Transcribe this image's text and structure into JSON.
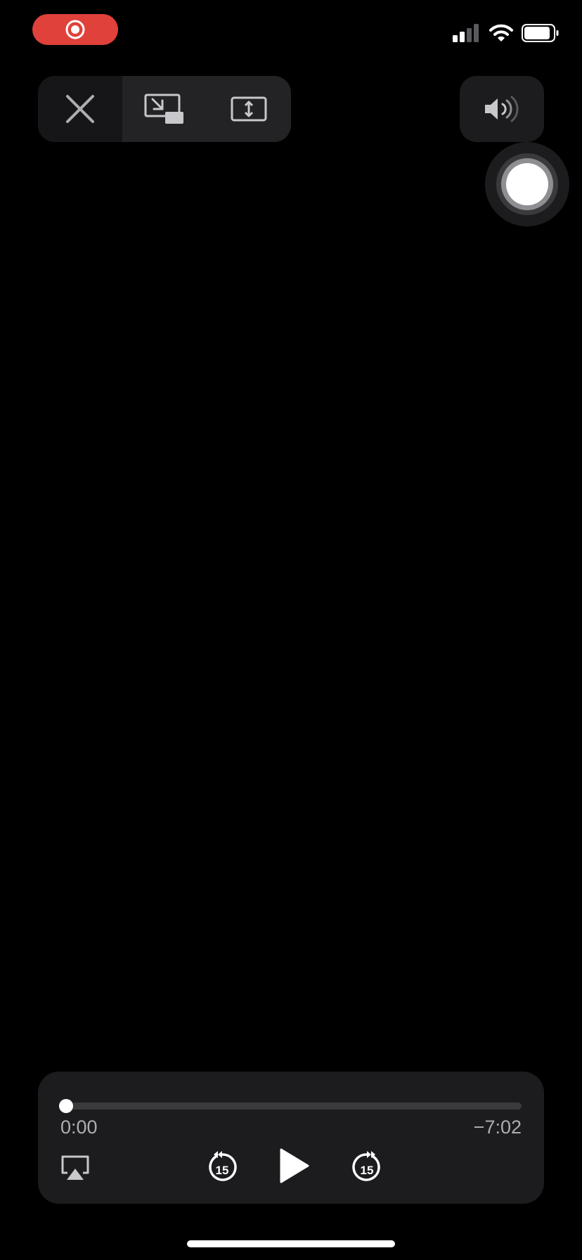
{
  "status_bar": {
    "recording_icon": "screen-record-icon",
    "signal_icon": "cellular-signal-icon",
    "signal_bars_active": 2,
    "signal_bars_total": 4,
    "wifi_icon": "wifi-icon",
    "battery_icon": "battery-icon",
    "battery_level": 0.9
  },
  "top_controls": {
    "close_icon": "close-icon",
    "pip_icon": "picture-in-picture-icon",
    "fit_icon": "aspect-fit-icon",
    "volume_icon": "speaker-volume-icon"
  },
  "assistive_touch": {
    "icon": "assistive-touch-icon"
  },
  "player": {
    "progress": 0.0,
    "elapsed": "0:00",
    "remaining": "−7:02",
    "airplay_icon": "airplay-icon",
    "skip_back_icon": "skip-back-icon",
    "skip_back_label": "15",
    "play_icon": "play-icon",
    "skip_forward_icon": "skip-forward-icon",
    "skip_forward_label": "15"
  },
  "colors": {
    "record_red": "#e0413b",
    "panel": "#1c1c1e",
    "icon_grey": "#c7c7cc"
  }
}
